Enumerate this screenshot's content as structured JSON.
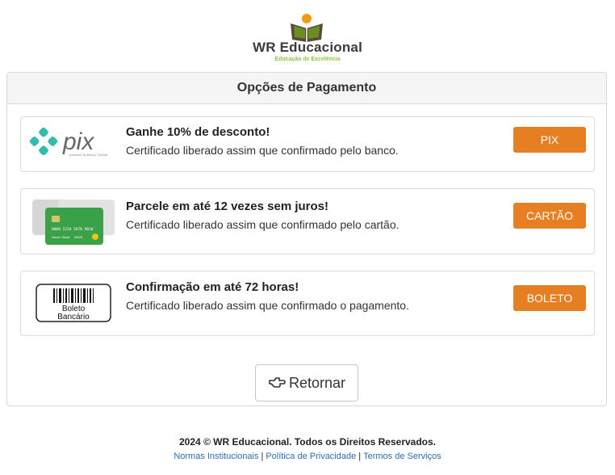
{
  "brand": {
    "name": "WR Educacional",
    "slogan": "Educação de Excelência"
  },
  "panel": {
    "title": "Opções de Pagamento"
  },
  "options": [
    {
      "icon": "pix-logo-icon",
      "logo_word": "pix",
      "logo_caption": "powered by Banco Central",
      "title": "Ganhe 10% de desconto!",
      "description": "Certificado liberado assim que confirmado pelo banco.",
      "button": "PIX"
    },
    {
      "icon": "credit-card-icon",
      "card_number": "0000 1234 5678 9010",
      "card_holder": "Nome Titular",
      "card_expiry": "09/26",
      "title": "Parcele em até 12 vezes sem juros!",
      "description": "Certificado liberado assim que confirmado pelo cartão.",
      "button": "CARTÃO"
    },
    {
      "icon": "barcode-icon",
      "logo_line1": "Boleto",
      "logo_line2": "Bancário",
      "title": "Confirmação em até 72 horas!",
      "description": "Certificado liberado assim que confirmado o pagamento.",
      "button": "BOLETO"
    }
  ],
  "return_button": "Retornar",
  "footer": {
    "copyright": "2024 © WR Educacional. Todos os Direitos Reservados.",
    "links": [
      "Normas Institucionais",
      "Política de Privacidade",
      "Termos de Serviços"
    ]
  },
  "colors": {
    "accent": "#e67e22",
    "link": "#2a6db0",
    "brand_green": "#8cc63f",
    "brand_orange": "#f39c12",
    "pix_teal": "#32bcad"
  }
}
